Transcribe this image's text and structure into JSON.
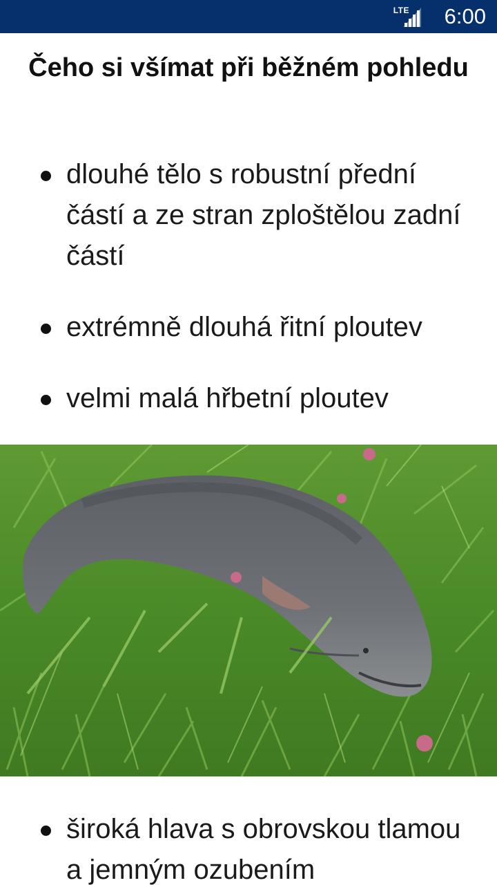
{
  "status_bar": {
    "network": "LTE",
    "time": "6:00",
    "background_color": "#05306b",
    "signal_icon": "signal-bars-icon"
  },
  "page": {
    "title": "Čeho si všímat při běžném pohledu",
    "bullets_top": [
      "dlouhé tělo s robustní přední částí a ze stran zploštělou zadní částí",
      "extrémně dlouhá řitní ploutev",
      "velmi malá hřbetní ploutev"
    ],
    "photo": {
      "subject": "fish-photo"
    },
    "bullets_bottom": [
      "široká hlava s obrovskou tlamou a jemným ozubením"
    ]
  }
}
